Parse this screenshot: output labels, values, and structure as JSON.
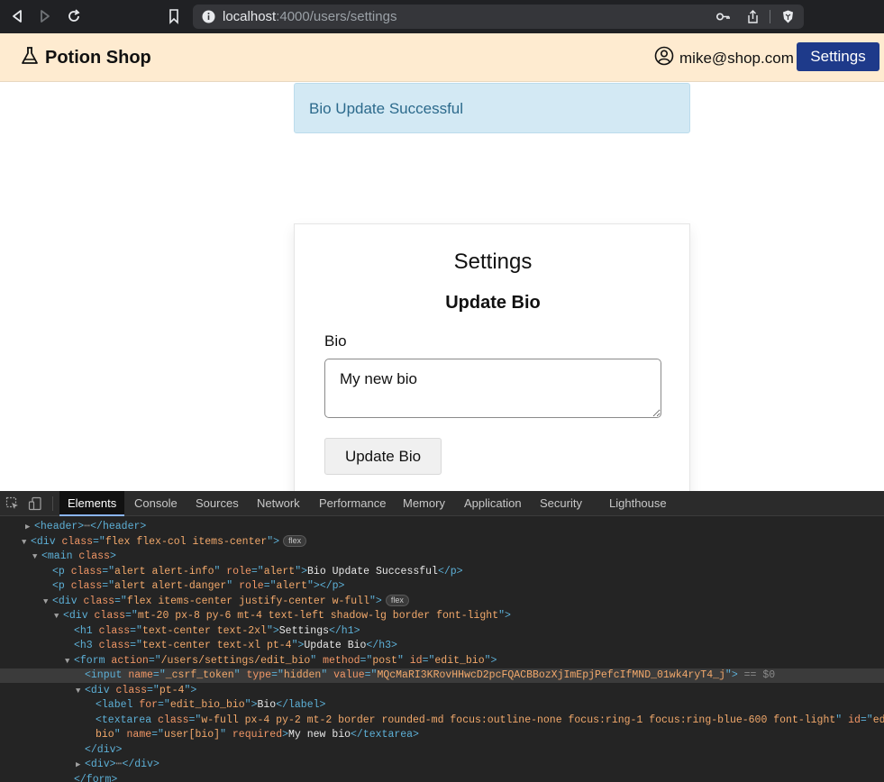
{
  "browser": {
    "url_host": "localhost",
    "url_path": ":4000/users/settings"
  },
  "header": {
    "brand": "Potion Shop",
    "user_email": "mike@shop.com",
    "settings_label": "Settings"
  },
  "alert": {
    "text": "Bio Update Successful"
  },
  "card": {
    "title": "Settings",
    "subtitle": "Update Bio",
    "bio_label": "Bio",
    "bio_value": "My new bio",
    "submit_label": "Update Bio"
  },
  "devtools": {
    "tabs": [
      "Elements",
      "Console",
      "Sources",
      "Network",
      "Performance",
      "Memory",
      "Application",
      "Security",
      "Lighthouse"
    ],
    "active_tab": "Elements",
    "lines": [
      {
        "indent": 28,
        "html": "<span class='tri'>▶</span><span class='tag'>&lt;header&gt;</span><span class='dots'>⋯</span><span class='tag'>&lt;/header&gt;</span>"
      },
      {
        "indent": 24,
        "html": "<span class='tri'>▼</span><span class='tag'>&lt;div </span><span class='attr-name'>class</span><span class='tag'>=\"</span><span class='str'>flex flex-col items-center</span><span class='tag'>\"&gt;</span><span class='badge'>flex</span>"
      },
      {
        "indent": 36,
        "html": "<span class='tri'>▼</span><span class='tag'>&lt;main </span><span class='attr-name'>class</span><span class='tag'>&gt;</span>"
      },
      {
        "indent": 58,
        "html": "<span class='tag'>&lt;p </span><span class='attr-name'>class</span><span class='tag'>=\"</span><span class='str'>alert alert-info</span><span class='tag'>\" </span><span class='attr-name'>role</span><span class='tag'>=\"</span><span class='str'>alert</span><span class='tag'>\"&gt;</span><span class='txt'>Bio Update Successful</span><span class='tag'>&lt;/p&gt;</span>"
      },
      {
        "indent": 58,
        "html": "<span class='tag'>&lt;p </span><span class='attr-name'>class</span><span class='tag'>=\"</span><span class='str'>alert alert-danger</span><span class='tag'>\" </span><span class='attr-name'>role</span><span class='tag'>=\"</span><span class='str'>alert</span><span class='tag'>\"&gt;&lt;/p&gt;</span>"
      },
      {
        "indent": 48,
        "html": "<span class='tri'>▼</span><span class='tag'>&lt;div </span><span class='attr-name'>class</span><span class='tag'>=\"</span><span class='str'>flex items-center justify-center w-full</span><span class='tag'>\"&gt;</span><span class='badge'>flex</span>"
      },
      {
        "indent": 60,
        "html": "<span class='tri'>▼</span><span class='tag'>&lt;div </span><span class='attr-name'>class</span><span class='tag'>=\"</span><span class='str'>mt-20 px-8 py-6 mt-4 text-left shadow-lg border font-light</span><span class='tag'>\"&gt;</span>"
      },
      {
        "indent": 82,
        "html": "<span class='tag'>&lt;h1 </span><span class='attr-name'>class</span><span class='tag'>=\"</span><span class='str'>text-center text-2xl</span><span class='tag'>\"&gt;</span><span class='txt'>Settings</span><span class='tag'>&lt;/h1&gt;</span>"
      },
      {
        "indent": 82,
        "html": "<span class='tag'>&lt;h3 </span><span class='attr-name'>class</span><span class='tag'>=\"</span><span class='str'>text-center text-xl pt-4</span><span class='tag'>\"&gt;</span><span class='txt'>Update Bio</span><span class='tag'>&lt;/h3&gt;</span>"
      },
      {
        "indent": 72,
        "html": "<span class='tri'>▼</span><span class='tag'>&lt;form </span><span class='attr-name'>action</span><span class='tag'>=\"</span><span class='str'>/users/settings/edit_bio</span><span class='tag'>\" </span><span class='attr-name'>method</span><span class='tag'>=\"</span><span class='str'>post</span><span class='tag'>\" </span><span class='attr-name'>id</span><span class='tag'>=\"</span><span class='str'>edit_bio</span><span class='tag'>\"&gt;</span>"
      },
      {
        "indent": 94,
        "selected": true,
        "html": "<span class='tag'>&lt;input </span><span class='attr-name'>name</span><span class='tag'>=\"</span><span class='str'>_csrf_token</span><span class='tag'>\" </span><span class='attr-name'>type</span><span class='tag'>=\"</span><span class='str'>hidden</span><span class='tag'>\" </span><span class='attr-name'>value</span><span class='tag'>=\"</span><span class='str'>MQcMaRI3KRovHHwcD2pcFQACBBozXjImEpjPefcIfMND_01wk4ryT4_j</span><span class='tag'>\"&gt;</span><span class='eq'> == $0</span>"
      },
      {
        "indent": 84,
        "html": "<span class='tri'>▼</span><span class='tag'>&lt;div </span><span class='attr-name'>class</span><span class='tag'>=\"</span><span class='str'>pt-4</span><span class='tag'>\"&gt;</span>"
      },
      {
        "indent": 106,
        "html": "<span class='tag'>&lt;label </span><span class='attr-name'>for</span><span class='tag'>=\"</span><span class='str'>edit_bio_bio</span><span class='tag'>\"&gt;</span><span class='txt'>Bio</span><span class='tag'>&lt;/label&gt;</span>"
      },
      {
        "indent": 106,
        "html": "<span class='tag'>&lt;textarea </span><span class='attr-name'>class</span><span class='tag'>=\"</span><span class='str'>w-full px-4 py-2 mt-2 border rounded-md focus:outline-none focus:ring-1 focus:ring-blue-600 font-light</span><span class='tag'>\" </span><span class='attr-name'>id</span><span class='tag'>=\"</span><span class='str'>edit_bi</span>"
      },
      {
        "indent": 106,
        "html": "<span class='str'>bio</span><span class='tag'>\" </span><span class='attr-name'>name</span><span class='tag'>=\"</span><span class='str'>user[bio]</span><span class='tag'>\" </span><span class='attr-name'>required</span><span class='tag'>&gt;</span><span class='txt'>My new bio</span><span class='tag'>&lt;/textarea&gt;</span>"
      },
      {
        "indent": 94,
        "html": "<span class='tag'>&lt;/div&gt;</span>"
      },
      {
        "indent": 84,
        "html": "<span class='tri'>▶</span><span class='tag'>&lt;div&gt;</span><span class='dots'>⋯</span><span class='tag'>&lt;/div&gt;</span>"
      },
      {
        "indent": 82,
        "html": "<span class='tag'>&lt;/form&gt;</span>"
      }
    ]
  }
}
